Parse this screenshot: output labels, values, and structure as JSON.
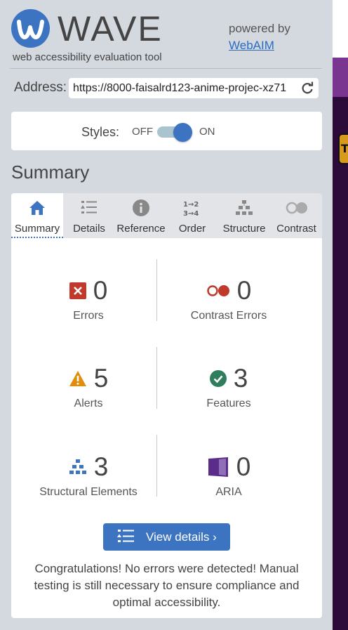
{
  "header": {
    "title": "WAVE",
    "tagline": "web accessibility evaluation tool",
    "powered_by": "powered by",
    "webaim_link": "WebAIM"
  },
  "address": {
    "label": "Address:",
    "value": "https://8000-faisalrd123-anime-projec-xz71"
  },
  "styles": {
    "label": "Styles:",
    "off": "OFF",
    "on": "ON",
    "state": "on"
  },
  "summary_heading": "Summary",
  "tabs": [
    {
      "label": "Summary",
      "icon": "home-icon",
      "active": true
    },
    {
      "label": "Details",
      "icon": "details-list-icon"
    },
    {
      "label": "Reference",
      "icon": "info-icon"
    },
    {
      "label": "Order",
      "icon": "order-icon"
    },
    {
      "label": "Structure",
      "icon": "structure-icon"
    },
    {
      "label": "Contrast",
      "icon": "contrast-icon"
    }
  ],
  "stats": {
    "errors": {
      "count": "0",
      "label": "Errors",
      "icon": "error-icon",
      "color": "#c0392b"
    },
    "contrast_errors": {
      "count": "0",
      "label": "Contrast Errors",
      "icon": "contrast-error-icon",
      "color": "#c0392b"
    },
    "alerts": {
      "count": "5",
      "label": "Alerts",
      "icon": "alert-icon",
      "color": "#e08e0b"
    },
    "features": {
      "count": "3",
      "label": "Features",
      "icon": "feature-check-icon",
      "color": "#2e7d5b"
    },
    "structural": {
      "count": "3",
      "label": "Structural Elements",
      "icon": "structure-icon",
      "color": "#3d74c2"
    },
    "aria": {
      "count": "0",
      "label": "ARIA",
      "icon": "aria-icon",
      "color": "#5b2c8a"
    }
  },
  "view_details_label": "View details ›",
  "congrats": "Congratulations! No errors were detected! Manual testing is still necessary to ensure compliance and optimal accessibility."
}
